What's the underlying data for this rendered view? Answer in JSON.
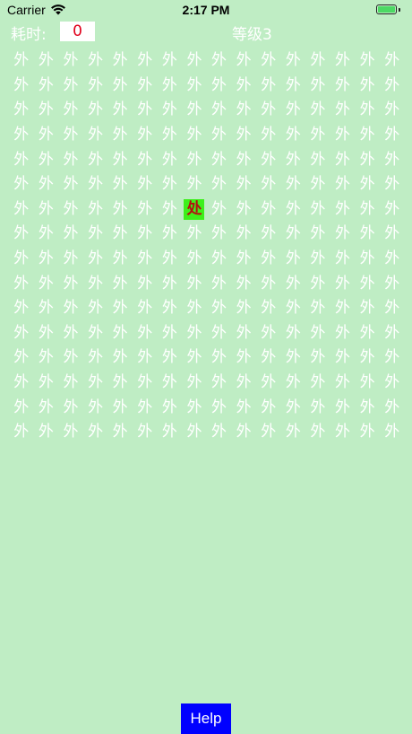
{
  "status_bar": {
    "carrier": "Carrier",
    "time": "2:17 PM",
    "wifi_icon": "wifi-icon",
    "battery_icon": "battery-icon",
    "battery_color": "#4cd964"
  },
  "hud": {
    "time_label": "耗时:",
    "time_value": "0",
    "level_label": "等级3"
  },
  "grid": {
    "rows": 16,
    "cols": 16,
    "filler_char": "外",
    "target_char": "处",
    "target_row": 7,
    "target_col": 8,
    "filler_color": "#ffffff",
    "target_bg_color": "#3df01b",
    "target_text_color": "#b50f10"
  },
  "help_button": {
    "label": "Help",
    "color": "#0000ff"
  },
  "colors": {
    "background": "#bfedc4",
    "time_value_color": "#e0001b"
  }
}
